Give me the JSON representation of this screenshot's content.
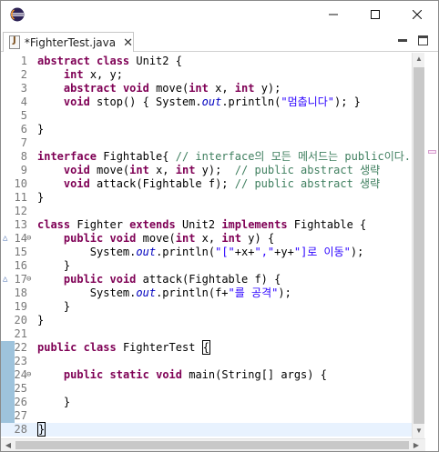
{
  "window": {
    "minimize_glyph": "—",
    "restore_glyph": "☐",
    "close_glyph": "✕"
  },
  "tab": {
    "label": "*FighterTest.java",
    "close_glyph": "✕"
  },
  "colors": {
    "keyword": "#7f0055",
    "comment": "#3f7f5f",
    "string": "#2a00ff",
    "static_field": "#0000c0",
    "line_number": "#787878",
    "current_line": "#e8f2fe",
    "change_bar": "#9ec3dc"
  },
  "editor": {
    "lines": [
      {
        "n": "1",
        "t": [
          {
            "c": "kw",
            "v": "abstract"
          },
          {
            "v": " "
          },
          {
            "c": "kw",
            "v": "class"
          },
          {
            "v": " Unit2 {"
          }
        ]
      },
      {
        "n": "2",
        "t": [
          {
            "v": "    "
          },
          {
            "c": "kw",
            "v": "int"
          },
          {
            "v": " x, y;"
          }
        ]
      },
      {
        "n": "3",
        "t": [
          {
            "v": "    "
          },
          {
            "c": "kw",
            "v": "abstract"
          },
          {
            "v": " "
          },
          {
            "c": "kw",
            "v": "void"
          },
          {
            "v": " move("
          },
          {
            "c": "kw",
            "v": "int"
          },
          {
            "v": " x, "
          },
          {
            "c": "kw",
            "v": "int"
          },
          {
            "v": " y);"
          }
        ]
      },
      {
        "n": "4",
        "t": [
          {
            "v": "    "
          },
          {
            "c": "kw",
            "v": "void"
          },
          {
            "v": " stop() { System."
          },
          {
            "c": "fld",
            "v": "out"
          },
          {
            "v": ".println("
          },
          {
            "c": "st",
            "v": "\"멈춥니다\""
          },
          {
            "v": "); }"
          }
        ]
      },
      {
        "n": "5",
        "t": []
      },
      {
        "n": "6",
        "t": [
          {
            "v": "}"
          }
        ]
      },
      {
        "n": "7",
        "t": []
      },
      {
        "n": "8",
        "t": [
          {
            "c": "kw",
            "v": "interface"
          },
          {
            "v": " Fightable{ "
          },
          {
            "c": "cm",
            "v": "// interface의 모든 메서드는 public이다."
          }
        ]
      },
      {
        "n": "9",
        "t": [
          {
            "v": "    "
          },
          {
            "c": "kw",
            "v": "void"
          },
          {
            "v": " move("
          },
          {
            "c": "kw",
            "v": "int"
          },
          {
            "v": " x, "
          },
          {
            "c": "kw",
            "v": "int"
          },
          {
            "v": " y);  "
          },
          {
            "c": "cm",
            "v": "// public abstract 생략"
          }
        ]
      },
      {
        "n": "10",
        "t": [
          {
            "v": "    "
          },
          {
            "c": "kw",
            "v": "void"
          },
          {
            "v": " attack(Fightable f); "
          },
          {
            "c": "cm",
            "v": "// public abstract 생략"
          }
        ]
      },
      {
        "n": "11",
        "t": [
          {
            "v": "}"
          }
        ]
      },
      {
        "n": "12",
        "t": []
      },
      {
        "n": "13",
        "t": [
          {
            "c": "kw",
            "v": "class"
          },
          {
            "v": " Fighter "
          },
          {
            "c": "kw",
            "v": "extends"
          },
          {
            "v": " Unit2 "
          },
          {
            "c": "kw",
            "v": "implements"
          },
          {
            "v": " Fightable {"
          }
        ]
      },
      {
        "n": "14",
        "marker": "override",
        "fold": true,
        "t": [
          {
            "v": "    "
          },
          {
            "c": "kw",
            "v": "public"
          },
          {
            "v": " "
          },
          {
            "c": "kw",
            "v": "void"
          },
          {
            "v": " move("
          },
          {
            "c": "kw",
            "v": "int"
          },
          {
            "v": " x, "
          },
          {
            "c": "kw",
            "v": "int"
          },
          {
            "v": " y) {"
          }
        ]
      },
      {
        "n": "15",
        "t": [
          {
            "v": "        System."
          },
          {
            "c": "fld",
            "v": "out"
          },
          {
            "v": ".println("
          },
          {
            "c": "st",
            "v": "\"[\""
          },
          {
            "v": "+x+"
          },
          {
            "c": "st",
            "v": "\",\""
          },
          {
            "v": "+y+"
          },
          {
            "c": "st",
            "v": "\"]로 이동\""
          },
          {
            "v": ");"
          }
        ]
      },
      {
        "n": "16",
        "t": [
          {
            "v": "    }"
          }
        ]
      },
      {
        "n": "17",
        "marker": "override",
        "fold": true,
        "t": [
          {
            "v": "    "
          },
          {
            "c": "kw",
            "v": "public"
          },
          {
            "v": " "
          },
          {
            "c": "kw",
            "v": "void"
          },
          {
            "v": " attack(Fightable f) {"
          }
        ]
      },
      {
        "n": "18",
        "t": [
          {
            "v": "        System."
          },
          {
            "c": "fld",
            "v": "out"
          },
          {
            "v": ".println(f+"
          },
          {
            "c": "st",
            "v": "\"를 공격\""
          },
          {
            "v": ");"
          }
        ]
      },
      {
        "n": "19",
        "t": [
          {
            "v": "    }"
          }
        ]
      },
      {
        "n": "20",
        "t": [
          {
            "v": "}"
          }
        ]
      },
      {
        "n": "21",
        "t": []
      },
      {
        "n": "22",
        "t": [
          {
            "c": "kw",
            "v": "public"
          },
          {
            "v": " "
          },
          {
            "c": "kw",
            "v": "class"
          },
          {
            "v": " FighterTest "
          },
          {
            "c": "box",
            "v": "{"
          }
        ]
      },
      {
        "n": "23",
        "t": []
      },
      {
        "n": "24",
        "fold": true,
        "t": [
          {
            "v": "    "
          },
          {
            "c": "kw",
            "v": "public"
          },
          {
            "v": " "
          },
          {
            "c": "kw",
            "v": "static"
          },
          {
            "v": " "
          },
          {
            "c": "kw",
            "v": "void"
          },
          {
            "v": " main(String[] args) {"
          }
        ]
      },
      {
        "n": "25",
        "t": []
      },
      {
        "n": "26",
        "t": [
          {
            "v": "    }"
          }
        ]
      },
      {
        "n": "27",
        "t": []
      },
      {
        "n": "28",
        "current": true,
        "t": [
          {
            "c": "box",
            "v": "}"
          }
        ]
      }
    ]
  }
}
